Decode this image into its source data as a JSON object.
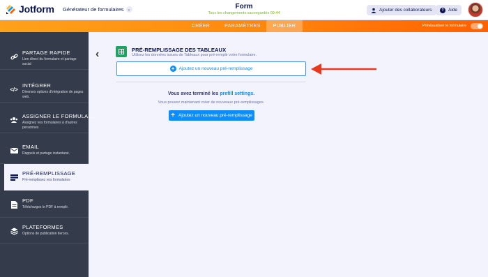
{
  "header": {
    "logo_text": "Jotform",
    "builder_selector": "Générateur de formulaires",
    "form_title": "Form",
    "save_status": "Tous les changements sauvegardés 09:44",
    "collab_label": "Ajouter des collaborateurs",
    "help_label": "Aide"
  },
  "tabs": [
    {
      "label": "CRÉER"
    },
    {
      "label": "PARAMÈTRES"
    },
    {
      "label": "PUBLIER"
    }
  ],
  "preview": {
    "label": "Prévisualiser le formulaire",
    "on": true
  },
  "sidebar": {
    "items": [
      {
        "title": "PARTAGE RAPIDE",
        "desc": "Lien direct du formulaire et partage social",
        "icon": "link-icon"
      },
      {
        "title": "INTÉGRER",
        "desc": "Diverses options d'intégration de pages web.",
        "icon": "code-icon"
      },
      {
        "title": "ASSIGNER LE FORMULAI...",
        "desc": "Assignez vos formulaires à d'autres personnes",
        "icon": "users-icon"
      },
      {
        "title": "EMAIL",
        "desc": "Rappels et partage instantané.",
        "icon": "envelope-icon"
      },
      {
        "title": "PRÉ-REMPLISSAGE",
        "desc": "Pré-remplissez vos formulaires",
        "icon": "prefill-icon",
        "active": true
      },
      {
        "title": "PDF",
        "desc": "Téléchargez le PDF à remplir.",
        "icon": "pdf-icon"
      },
      {
        "title": "PLATEFORMES",
        "desc": "Options de publication tierces.",
        "icon": "layers-icon"
      }
    ]
  },
  "content": {
    "title": "PRÉ-REMPLISSAGE DES TABLEAUX",
    "subtitle": "Utilisez les données issues de Tableaux pour pré-remplir votre formulaire.",
    "add_box_label": "Ajoutez un nouveau pré-remplissage",
    "done_prefix": "Vous avez terminé les",
    "done_link": "prefill settings.",
    "done_sub": "Vous pouvez maintenant créer de nouveaux pré-remplissages.",
    "add_button_label": "Ajoutez un nouveau pré-remplissage"
  },
  "colors": {
    "accent_orange": "#ff6100",
    "link_blue": "#0a8dff",
    "sidebar_bg": "#343c4b",
    "arrow_red": "#e8391d",
    "save_green": "#78bb07"
  }
}
